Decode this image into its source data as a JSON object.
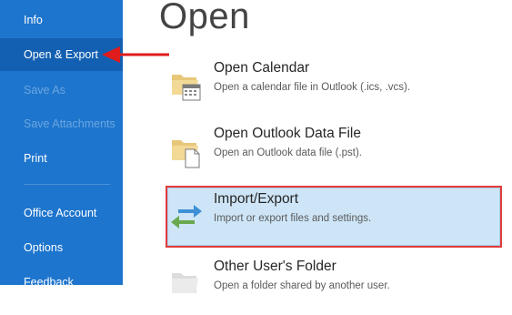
{
  "sidebar": {
    "items": [
      {
        "label": "Info",
        "state": "normal"
      },
      {
        "label": "Open & Export",
        "state": "selected"
      },
      {
        "label": "Save As",
        "state": "disabled"
      },
      {
        "label": "Save Attachments",
        "state": "disabled"
      },
      {
        "label": "Print",
        "state": "normal"
      },
      {
        "label": "Office Account",
        "state": "normal"
      },
      {
        "label": "Options",
        "state": "normal"
      },
      {
        "label": "Feedback",
        "state": "normal"
      }
    ]
  },
  "main": {
    "title": "Open",
    "options": [
      {
        "title": "Open Calendar",
        "description": "Open a calendar file in Outlook (.ics, .vcs).",
        "icon": "calendar-folder-icon"
      },
      {
        "title": "Open Outlook Data File",
        "description": "Open an Outlook data file (.pst).",
        "icon": "data-file-folder-icon"
      },
      {
        "title": "Import/Export",
        "description": "Import or export files and settings.",
        "icon": "import-export-arrows-icon",
        "highlighted": true
      },
      {
        "title": "Other User's Folder",
        "description": "Open a folder shared by another user.",
        "icon": "shared-folder-icon"
      }
    ]
  },
  "colors": {
    "sidebar_bg": "#1e75cd",
    "sidebar_selected": "#1360b2",
    "highlight_bg": "#cde5f7",
    "highlight_border": "#e23b3b",
    "annotation_arrow": "#e01b1b"
  }
}
